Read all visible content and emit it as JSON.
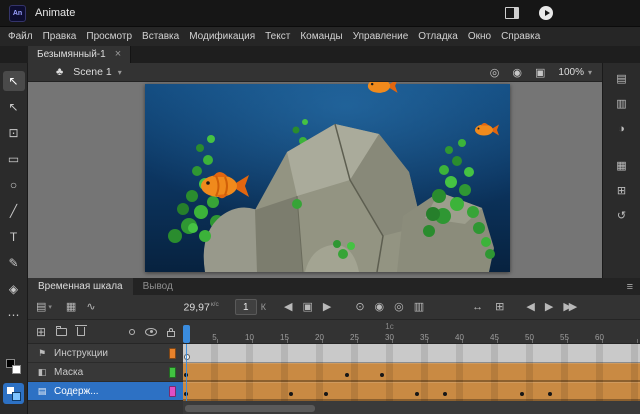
{
  "titlebar": {
    "app_name": "Animate",
    "app_badge": "An"
  },
  "menubar": {
    "items": [
      "Файл",
      "Правка",
      "Просмотр",
      "Вставка",
      "Модификация",
      "Текст",
      "Команды",
      "Управление",
      "Отладка",
      "Окно",
      "Справка"
    ]
  },
  "document_tab": {
    "title": "Безымянный-1",
    "close": "×"
  },
  "edit_bar": {
    "scene_glyph": "♣",
    "scene_name": "Scene 1",
    "chevron": "▾",
    "icons": [
      {
        "name": "center-frame-icon",
        "glyph": "◎"
      },
      {
        "name": "camera-icon",
        "glyph": "◉"
      },
      {
        "name": "clip-content-icon",
        "glyph": "▣"
      }
    ],
    "zoom": "100%",
    "zoom_chevron": "▾"
  },
  "tools": [
    {
      "name": "selection-tool",
      "glyph": "↖",
      "selected": true
    },
    {
      "name": "subselection-tool",
      "glyph": "↖"
    },
    {
      "name": "free-transform-tool",
      "glyph": "⊡"
    },
    {
      "name": "rectangle-tool",
      "glyph": "▭"
    },
    {
      "name": "oval-tool",
      "glyph": "○"
    },
    {
      "name": "line-tool",
      "glyph": "╱"
    },
    {
      "name": "text-tool",
      "glyph": "T"
    },
    {
      "name": "pencil-tool",
      "glyph": "✎"
    },
    {
      "name": "paint-bucket-tool",
      "glyph": "◈"
    },
    {
      "name": "more-tools",
      "glyph": "⋯"
    }
  ],
  "tool_colors": {
    "stroke": "#000000",
    "fill": "#ffffff"
  },
  "right_rail": [
    {
      "name": "properties-icon",
      "glyph": "▤"
    },
    {
      "name": "library-icon",
      "glyph": "▥"
    },
    {
      "name": "color-icon",
      "glyph": "◑"
    },
    {
      "name": "swatches-icon",
      "glyph": "▦"
    },
    {
      "name": "align-icon",
      "glyph": "⊞"
    },
    {
      "name": "history-icon",
      "glyph": "↺"
    }
  ],
  "timeline": {
    "tabs": [
      {
        "label": "Временная шкала",
        "active": true
      },
      {
        "label": "Вывод",
        "active": false
      }
    ],
    "panel_menu": "≡",
    "toolbar": {
      "layers_glyph": "▤",
      "layers_chevron": "▾",
      "frames_view_glyph": "▦",
      "motion_editor_glyph": "∿",
      "frame_rate": "29,97",
      "frame_rate_unit": "к/с",
      "current_frame": "1",
      "frame_unit": "К",
      "prev_glyph": "◀",
      "stop_glyph": "▣",
      "next_glyph": "▶",
      "insert_keyframe_glyph": "⊙",
      "onion_glyph": "◉",
      "onion_outline_glyph": "◎",
      "multi_frame_glyph": "▥",
      "fit_glyph": "↔",
      "zoom_glyph": "⊞",
      "transport_back": "◀",
      "transport_play": "▶",
      "transport_ff": "▶▶"
    },
    "layer_controls": {
      "new_layer_glyph": "⊞"
    },
    "ruler": {
      "numbers": [
        5,
        10,
        15,
        20,
        25,
        30,
        35,
        40,
        45,
        50,
        55,
        60
      ],
      "seconds": [
        {
          "frame": 30,
          "label": "1с"
        }
      ]
    },
    "layers": [
      {
        "name": "Инструкции",
        "type_icon": "guide-layer-icon",
        "type_glyph": "⚑",
        "swatch": "#E8822B",
        "frame_style": "plain",
        "keyframes": [],
        "keyframes_hollow": [
          1
        ]
      },
      {
        "name": "Маска",
        "type_icon": "mask-layer-icon",
        "type_glyph": "◧",
        "swatch": "#41C241",
        "frame_style": "tween",
        "keyframes": [
          1,
          24,
          29
        ]
      },
      {
        "name": "Содерж...",
        "type_icon": "layer-icon",
        "type_glyph": "▤",
        "swatch": "#E04FC4",
        "frame_style": "tween",
        "keyframes": [
          1,
          16,
          21,
          34,
          38,
          49,
          53
        ],
        "selected": true
      }
    ],
    "playhead_frame": 1,
    "colors": {
      "tween_fill": "#C98A43",
      "plain_fill": "#C9C9C9",
      "selected_row": "#2D71C4",
      "playhead": "#3A8CDE"
    }
  }
}
